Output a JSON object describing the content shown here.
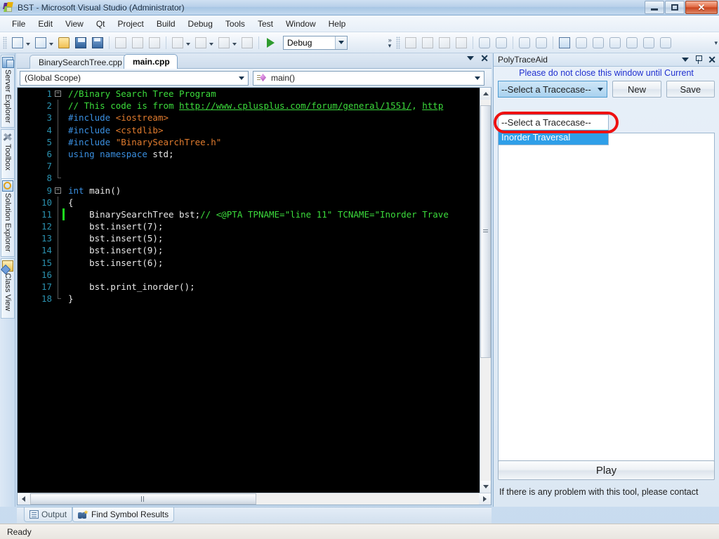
{
  "window": {
    "title": "BST - Microsoft Visual Studio (Administrator)",
    "logo_icon": "visual-studio-logo-icon",
    "minimize_icon": "minimize-icon",
    "maximize_icon": "restore-icon",
    "close_icon": "close-icon"
  },
  "menu": {
    "items": [
      {
        "label": "File"
      },
      {
        "label": "Edit"
      },
      {
        "label": "View"
      },
      {
        "label": "Qt"
      },
      {
        "label": "Project"
      },
      {
        "label": "Build"
      },
      {
        "label": "Debug"
      },
      {
        "label": "Tools"
      },
      {
        "label": "Test"
      },
      {
        "label": "Window"
      },
      {
        "label": "Help"
      }
    ]
  },
  "toolbar": {
    "new_project_icon": "new-project-icon",
    "new_item_icon": "new-item-icon",
    "open_file_icon": "open-folder-icon",
    "save_icon": "save-icon",
    "save_all_icon": "save-all-icon",
    "cut_icon": "cut-icon",
    "copy_icon": "copy-icon",
    "paste_icon": "paste-icon",
    "undo_icon": "undo-icon",
    "redo_icon": "redo-icon",
    "navigate_back_icon": "navigate-backward-icon",
    "navigate_forward_icon": "navigate-forward-icon",
    "start_debug_icon": "start-debugging-play-icon",
    "config_value": "Debug",
    "solution_explorer_icon": "solution-explorer-icon",
    "properties_icon": "properties-window-icon",
    "object_browser_icon": "object-browser-icon",
    "toolbox_icon": "toolbox-icon",
    "indent_icon": "increase-indent-icon",
    "outdent_icon": "decrease-indent-icon",
    "comment_icon": "comment-selection-icon",
    "uncomment_icon": "uncomment-selection-icon",
    "bookmark_window_icon": "bookmark-window-icon",
    "toggle_bookmark_icon": "toggle-bookmark-icon",
    "next_bookmark_icon": "next-bookmark-icon",
    "prev_bookmark_icon": "previous-bookmark-icon",
    "clear_bookmarks_icon": "clear-bookmarks-icon",
    "overflow_icon": "toolbar-overflow-icon"
  },
  "side_tabs": [
    {
      "label": "Server Explorer",
      "icon": "server-explorer-icon"
    },
    {
      "label": "Toolbox",
      "icon": "toolbox-icon"
    },
    {
      "label": "Solution Explorer",
      "icon": "solution-explorer-icon"
    },
    {
      "label": "Class View",
      "icon": "class-view-icon"
    }
  ],
  "document_tabs": {
    "tabs": [
      {
        "label": "BinarySearchTree.cpp",
        "active": false
      },
      {
        "label": "main.cpp",
        "active": true
      }
    ],
    "dropdown_icon": "active-files-dropdown-icon",
    "close_icon": "close-tab-icon"
  },
  "navbars": {
    "scope": "(Global Scope)",
    "member": "main()",
    "member_icon": "method-icon",
    "dropdown_icon": "chevron-down-icon"
  },
  "editor": {
    "lines": [
      {
        "num": "1",
        "fold": "minus",
        "changed": false,
        "tokens": [
          {
            "t": "//Binary Search Tree Program",
            "c": "c-com"
          }
        ]
      },
      {
        "num": "2",
        "fold": "pipe",
        "changed": false,
        "tokens": [
          {
            "t": "// This code is from ",
            "c": "c-com"
          },
          {
            "t": "http://www.cplusplus.com/forum/general/1551/",
            "c": "c-url"
          },
          {
            "t": ", ",
            "c": "c-com"
          },
          {
            "t": "http",
            "c": "c-url"
          }
        ]
      },
      {
        "num": "3",
        "fold": "pipe",
        "changed": false,
        "tokens": [
          {
            "t": "#include ",
            "c": "c-pre"
          },
          {
            "t": "<iostream>",
            "c": "c-str"
          }
        ]
      },
      {
        "num": "4",
        "fold": "pipe",
        "changed": false,
        "tokens": [
          {
            "t": "#include ",
            "c": "c-pre"
          },
          {
            "t": "<cstdlib>",
            "c": "c-str"
          }
        ]
      },
      {
        "num": "5",
        "fold": "pipe",
        "changed": false,
        "tokens": [
          {
            "t": "#include ",
            "c": "c-pre"
          },
          {
            "t": "\"BinarySearchTree.h\"",
            "c": "c-str"
          }
        ]
      },
      {
        "num": "6",
        "fold": "pipe",
        "changed": false,
        "tokens": [
          {
            "t": "using namespace ",
            "c": "c-kw"
          },
          {
            "t": "std;",
            "c": "c-txt"
          }
        ]
      },
      {
        "num": "7",
        "fold": "pipe",
        "changed": false,
        "tokens": []
      },
      {
        "num": "8",
        "fold": "end",
        "changed": false,
        "tokens": []
      },
      {
        "num": "9",
        "fold": "minus",
        "changed": false,
        "tokens": [
          {
            "t": "int ",
            "c": "c-kw"
          },
          {
            "t": "main()",
            "c": "c-txt"
          }
        ]
      },
      {
        "num": "10",
        "fold": "pipe",
        "changed": false,
        "tokens": [
          {
            "t": "{",
            "c": "c-txt"
          }
        ]
      },
      {
        "num": "11",
        "fold": "pipe",
        "changed": true,
        "tokens": [
          {
            "t": "    BinarySearchTree bst;",
            "c": "c-txt"
          },
          {
            "t": "// <@PTA TPNAME=\"line 11\" TCNAME=\"Inorder Trave",
            "c": "c-com"
          }
        ]
      },
      {
        "num": "12",
        "fold": "pipe",
        "changed": false,
        "tokens": [
          {
            "t": "    bst.insert(7);",
            "c": "c-txt"
          }
        ]
      },
      {
        "num": "13",
        "fold": "pipe",
        "changed": false,
        "tokens": [
          {
            "t": "    bst.insert(5);",
            "c": "c-txt"
          }
        ]
      },
      {
        "num": "14",
        "fold": "pipe",
        "changed": false,
        "tokens": [
          {
            "t": "    bst.insert(9);",
            "c": "c-txt"
          }
        ]
      },
      {
        "num": "15",
        "fold": "pipe",
        "changed": false,
        "tokens": [
          {
            "t": "    bst.insert(6);",
            "c": "c-txt"
          }
        ]
      },
      {
        "num": "16",
        "fold": "pipe",
        "changed": false,
        "tokens": []
      },
      {
        "num": "17",
        "fold": "pipe",
        "changed": false,
        "tokens": [
          {
            "t": "    bst.print_inorder();",
            "c": "c-txt"
          }
        ]
      },
      {
        "num": "18",
        "fold": "end",
        "changed": false,
        "tokens": [
          {
            "t": "}",
            "c": "c-txt"
          }
        ]
      }
    ],
    "vscroll_up_icon": "scroll-up-icon",
    "vscroll_down_icon": "scroll-down-icon",
    "hscroll_left_icon": "scroll-left-icon",
    "hscroll_right_icon": "scroll-right-icon"
  },
  "bottom_tabs": [
    {
      "label": "Output",
      "icon": "output-window-icon",
      "active": false
    },
    {
      "label": "Find Symbol Results",
      "icon": "find-symbol-results-icon",
      "active": true
    }
  ],
  "statusbar": {
    "text": "Ready"
  },
  "polytraceaid": {
    "title": "PolyTraceAid",
    "dropdown_icon": "window-menu-icon",
    "pin_icon": "auto-hide-pin-icon",
    "close_icon": "close-icon",
    "note": "Please do not close this window until Current",
    "tracecase_selected": "--Select a Tracecase--",
    "tracecase_caret_icon": "chevron-down-icon",
    "new_label": "New",
    "save_label": "Save",
    "dropdown_options": [
      {
        "label": "--Select a Tracecase--",
        "selected": false
      },
      {
        "label": "Inorder Traversal",
        "selected": true
      }
    ],
    "play_label": "Play",
    "footer": "If there is any problem with this tool, please contact",
    "annotation_color": "#ee1111"
  }
}
